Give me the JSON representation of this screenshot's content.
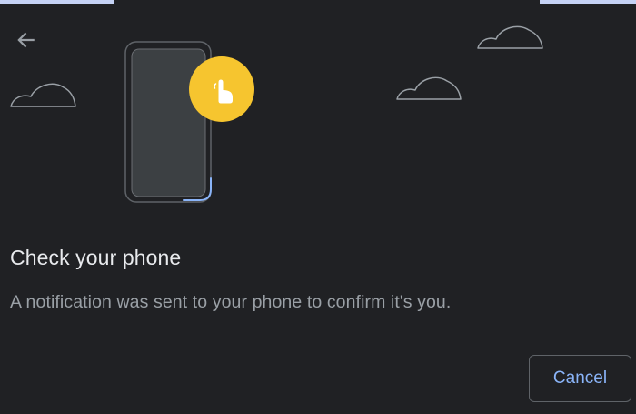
{
  "header": {
    "back_icon": "arrow-left-icon"
  },
  "illustration": {
    "phone_icon": "phone-icon",
    "touch_icon": "hand-pointer-icon",
    "touch_badge_color": "#f6c52f",
    "cloud_icon": "cloud-icon"
  },
  "dialog": {
    "title": "Check your phone",
    "message": "A notification was sent to your phone to confirm it's you.",
    "cancel_label": "Cancel"
  },
  "colors": {
    "background": "#202124",
    "accent": "#8ab4f8",
    "title_text": "#e8eaed",
    "body_text": "#9aa0a6"
  }
}
